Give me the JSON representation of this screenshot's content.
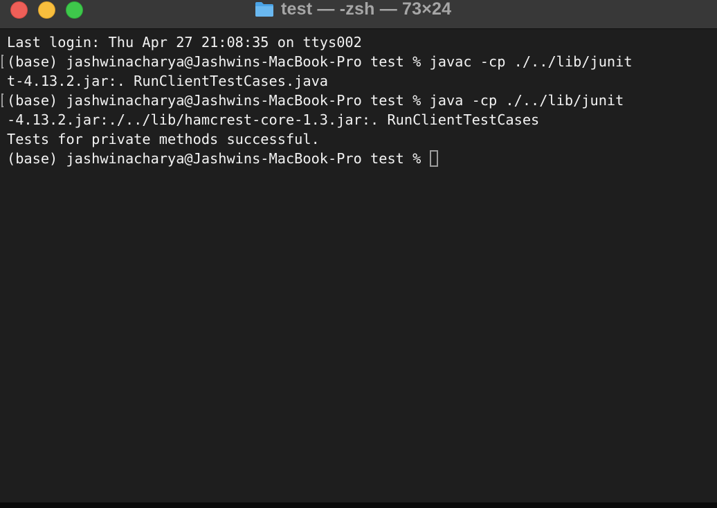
{
  "window": {
    "title": "test — -zsh — 73×24",
    "icon": "folder-icon"
  },
  "terminal": {
    "lines": [
      "Last login: Thu Apr 27 21:08:35 on ttys002",
      "(base) jashwinacharya@Jashwins-MacBook-Pro test % javac -cp ./../lib/junit",
      "t-4.13.2.jar:. RunClientTestCases.java",
      "(base) jashwinacharya@Jashwins-MacBook-Pro test % java -cp ./../lib/junit",
      "-4.13.2.jar:./../lib/hamcrest-core-1.3.jar:. RunClientTestCases",
      "Tests for private methods successful.",
      "(base) jashwinacharya@Jashwins-MacBook-Pro test % "
    ]
  },
  "colors": {
    "background": "#1e1e1e",
    "titlebar": "#383838",
    "text": "#f2f2f2",
    "close": "#ee5f58",
    "minimize": "#f8be3d",
    "zoom": "#3ec84b"
  }
}
